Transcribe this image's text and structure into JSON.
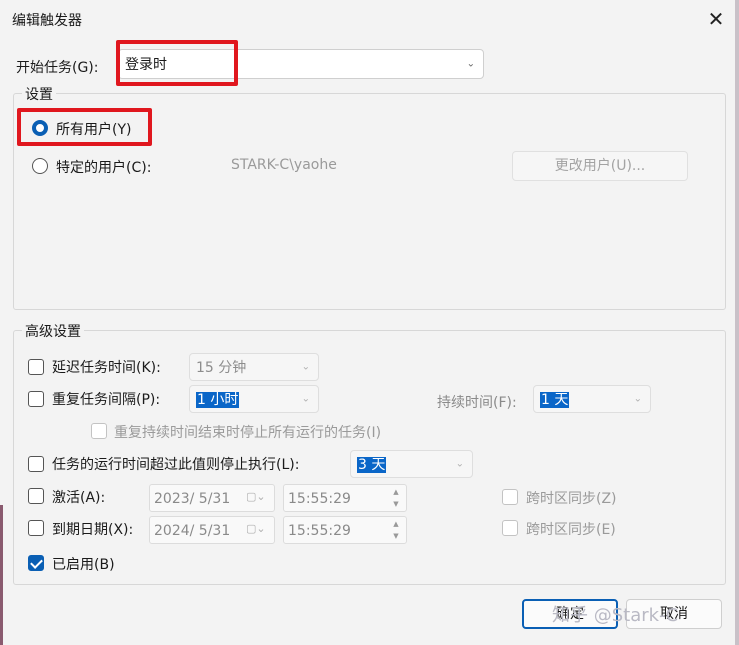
{
  "window": {
    "title": "编辑触发器",
    "close_glyph": "✕"
  },
  "begin_task": {
    "label": "开始任务(G):",
    "value": "登录时"
  },
  "settings": {
    "group_title": "设置",
    "all_users_label": "所有用户(Y)",
    "specific_user_label": "特定的用户(C):",
    "specific_user_value": "STARK-C\\yaohe",
    "change_user_button": "更改用户(U)..."
  },
  "advanced": {
    "group_title": "高级设置",
    "delay_label": "延迟任务时间(K):",
    "delay_value": "15 分钟",
    "repeat_label": "重复任务间隔(P):",
    "repeat_value": "1 小时",
    "duration_label": "持续时间(F):",
    "duration_value": "1 天",
    "stop_all_label": "重复持续时间结束时停止所有运行的任务(I)",
    "stop_if_longer_label": "任务的运行时间超过此值则停止执行(L):",
    "stop_if_longer_value": "3 天",
    "activate_label": "激活(A):",
    "activate_date": "2023/  5/31",
    "activate_time": "15:55:29",
    "activate_sync_label": "跨时区同步(Z)",
    "expire_label": "到期日期(X):",
    "expire_date": "2024/  5/31",
    "expire_time": "15:55:29",
    "expire_sync_label": "跨时区同步(E)",
    "enabled_label": "已启用(B)",
    "enabled_checked": true
  },
  "buttons": {
    "ok": "确定",
    "cancel": "取消"
  },
  "watermark": "知乎 @Stark-C",
  "colors": {
    "accent": "#0a5fb4",
    "highlight_box": "#e0171e"
  },
  "icons": {
    "dropdown": "chevron-down-icon",
    "calendar": "calendar-icon"
  }
}
